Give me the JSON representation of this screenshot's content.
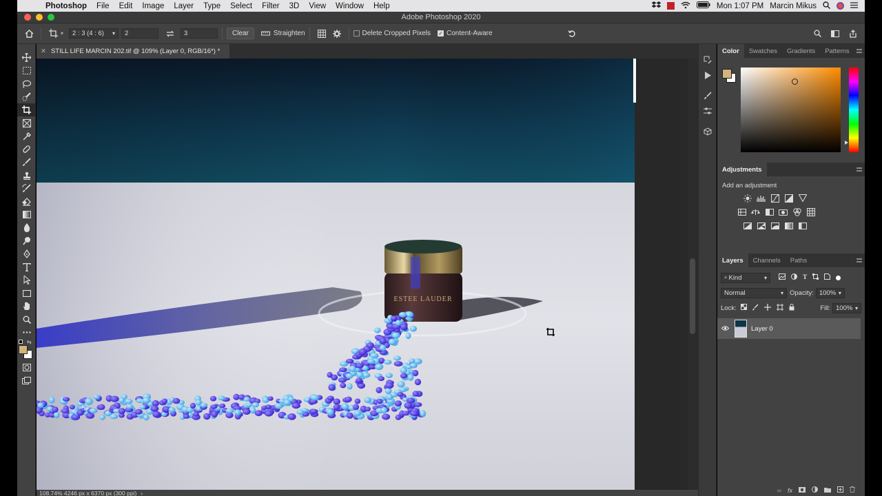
{
  "menubar": {
    "app_name": "Photoshop",
    "items": [
      "File",
      "Edit",
      "Image",
      "Layer",
      "Type",
      "Select",
      "Filter",
      "3D",
      "View",
      "Window",
      "Help"
    ],
    "clock": "Mon 1:07 PM",
    "user": "Marcin Mikus"
  },
  "window": {
    "title": "Adobe Photoshop 2020"
  },
  "options": {
    "ratio_preset": "2 : 3 (4 : 6)",
    "width_value": "2",
    "height_value": "3",
    "clear_label": "Clear",
    "straighten_label": "Straighten",
    "delete_cropped_label": "Delete Cropped Pixels",
    "delete_cropped_checked": false,
    "content_aware_label": "Content-Aware",
    "content_aware_checked": true
  },
  "document": {
    "tab_title": "STILL LIFE MARCIN 202.tif @ 109% (Layer 0, RGB/16*) *",
    "status": "108.74%   4246 px x 6370 px (300 ppi)",
    "label_brand": "ESTEE LAUDER"
  },
  "color_panel": {
    "tabs": [
      "Color",
      "Swatches",
      "Gradients",
      "Patterns"
    ],
    "foreground": "#d4b47c",
    "background": "#ffffff"
  },
  "adjustments_panel": {
    "tab": "Adjustments",
    "hint": "Add an adjustment"
  },
  "layers_panel": {
    "tabs": [
      "Layers",
      "Channels",
      "Paths"
    ],
    "filter_kind": "Kind",
    "blend_mode": "Normal",
    "opacity_label": "Opacity:",
    "opacity_value": "100%",
    "lock_label": "Lock:",
    "fill_label": "Fill:",
    "fill_value": "100%",
    "layers": [
      {
        "name": "Layer 0",
        "visible": true
      }
    ]
  }
}
